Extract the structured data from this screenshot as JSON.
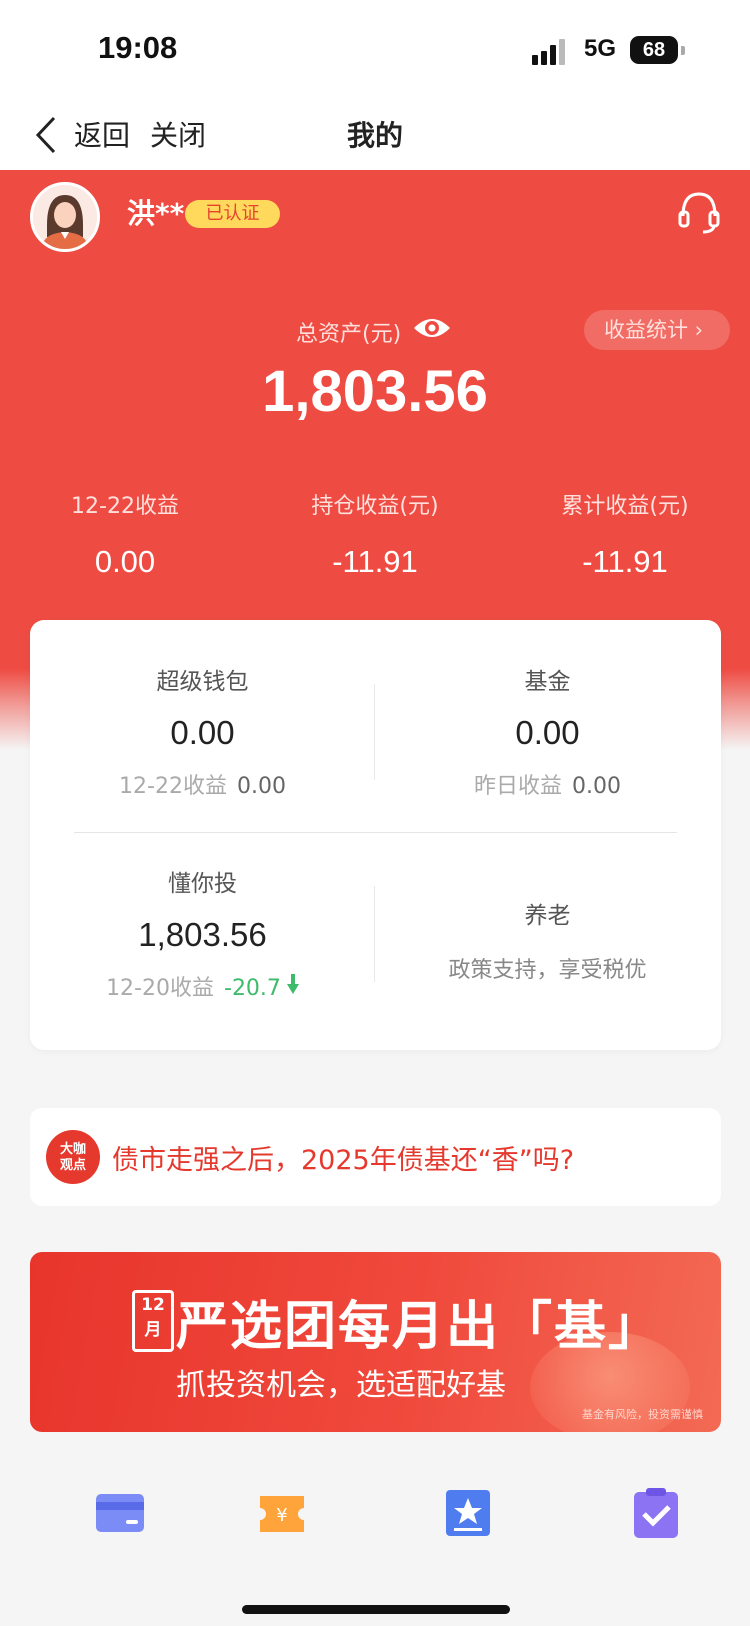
{
  "status_bar": {
    "time": "19:08",
    "network": "5G",
    "battery": "68"
  },
  "nav": {
    "back_label": "返回",
    "close_label": "关闭",
    "title": "我的"
  },
  "user": {
    "name": "洪**",
    "badge": "已认证"
  },
  "assets": {
    "total_label": "总资产(元)",
    "total_value": "1,803.56",
    "stats_button": "收益统计 ›",
    "metrics": [
      {
        "label": "12-22收益",
        "value": "0.00"
      },
      {
        "label": "持仓收益(元)",
        "value": "-11.91"
      },
      {
        "label": "累计收益(元)",
        "value": "-11.91"
      }
    ]
  },
  "card": {
    "wallet": {
      "title": "超级钱包",
      "value": "0.00",
      "sub_label": "12-22收益",
      "sub_value": "0.00"
    },
    "fund": {
      "title": "基金",
      "value": "0.00",
      "sub_label": "昨日收益",
      "sub_value": "0.00"
    },
    "smart": {
      "title": "懂你投",
      "value": "1,803.56",
      "sub_label": "12-20收益",
      "sub_value": "-20.7"
    },
    "pension": {
      "title": "养老",
      "desc": "政策支持，享受税优"
    }
  },
  "news": {
    "badge_line1": "大咖",
    "badge_line2": "观点",
    "text": "债市走强之后，2025年债基还“香”吗?"
  },
  "banner": {
    "month": "12月",
    "title": "严选团每月出「基」",
    "subtitle": "抓投资机会，选适配好基",
    "risk_note": "基金有风险，投资需谨慎"
  },
  "colors": {
    "primary_red": "#ee4c43",
    "negative_green": "#3dbb6a",
    "badge_yellow": "#ffd95c"
  },
  "shortcuts": [
    {
      "icon": "card-icon"
    },
    {
      "icon": "coupon-icon"
    },
    {
      "icon": "certificate-icon"
    },
    {
      "icon": "clipboard-check-icon"
    }
  ]
}
